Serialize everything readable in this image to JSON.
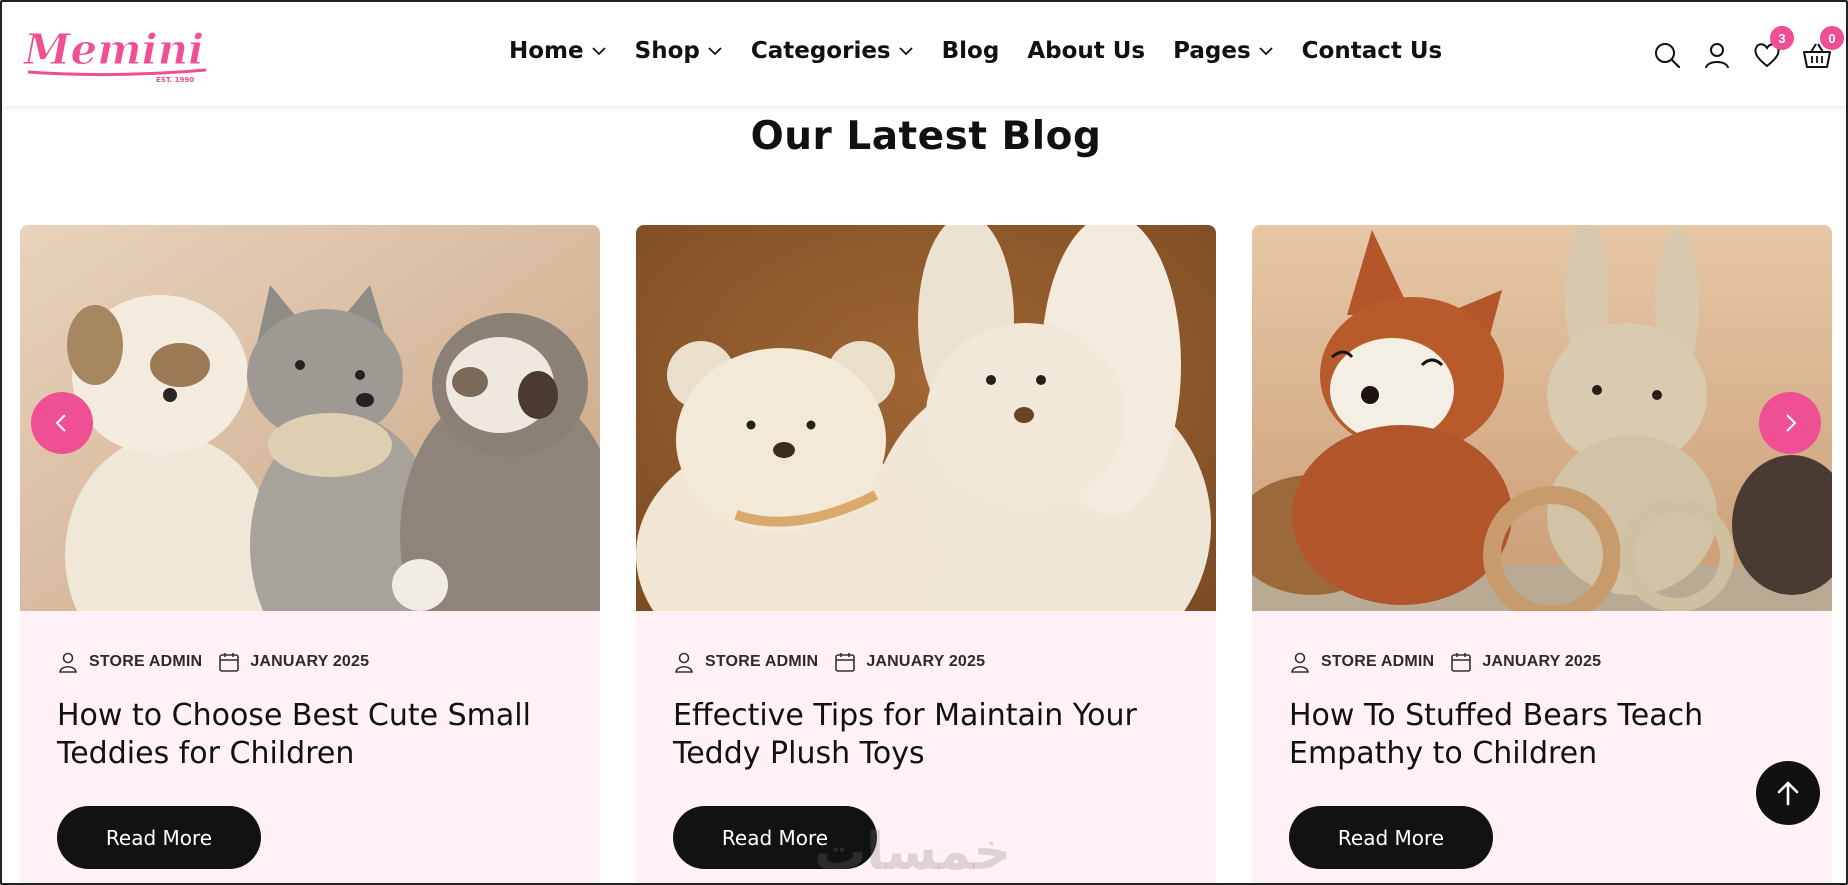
{
  "brand": {
    "logo_text": "Memini",
    "logo_sub": "EST. 1990",
    "accent": "#ef4f93"
  },
  "nav": {
    "items": [
      {
        "label": "Home",
        "has_dropdown": true
      },
      {
        "label": "Shop",
        "has_dropdown": true
      },
      {
        "label": "Categories",
        "has_dropdown": true
      },
      {
        "label": "Blog",
        "has_dropdown": false
      },
      {
        "label": "About Us",
        "has_dropdown": false
      },
      {
        "label": "Pages",
        "has_dropdown": true
      },
      {
        "label": "Contact Us",
        "has_dropdown": false
      }
    ]
  },
  "header_icons": {
    "search": "search-icon",
    "account": "user-icon",
    "wishlist": {
      "icon": "heart-icon",
      "count": "3"
    },
    "cart": {
      "icon": "basket-icon",
      "count": "0"
    }
  },
  "section": {
    "title": "Our Latest Blog"
  },
  "posts": [
    {
      "author": "STORE ADMIN",
      "date": "JANUARY 2025",
      "title": "How to Choose Best Cute Small Teddies for Children",
      "button": "Read More",
      "image": "knitted-dog-wolf-sloth-plush"
    },
    {
      "author": "STORE ADMIN",
      "date": "JANUARY 2025",
      "title": "Effective Tips for Maintain Your Teddy Plush Toys",
      "button": "Read More",
      "image": "white-teddy-bear-and-bunny"
    },
    {
      "author": "STORE ADMIN",
      "date": "JANUARY 2025",
      "title": "How To Stuffed Bears Teach Empathy to Children",
      "button": "Read More",
      "image": "crochet-fox-and-bunny"
    }
  ],
  "carousel": {
    "prev": "chevron-left-icon",
    "next": "chevron-right-icon"
  },
  "back_to_top": "arrow-up-icon",
  "watermark": "خمسات"
}
